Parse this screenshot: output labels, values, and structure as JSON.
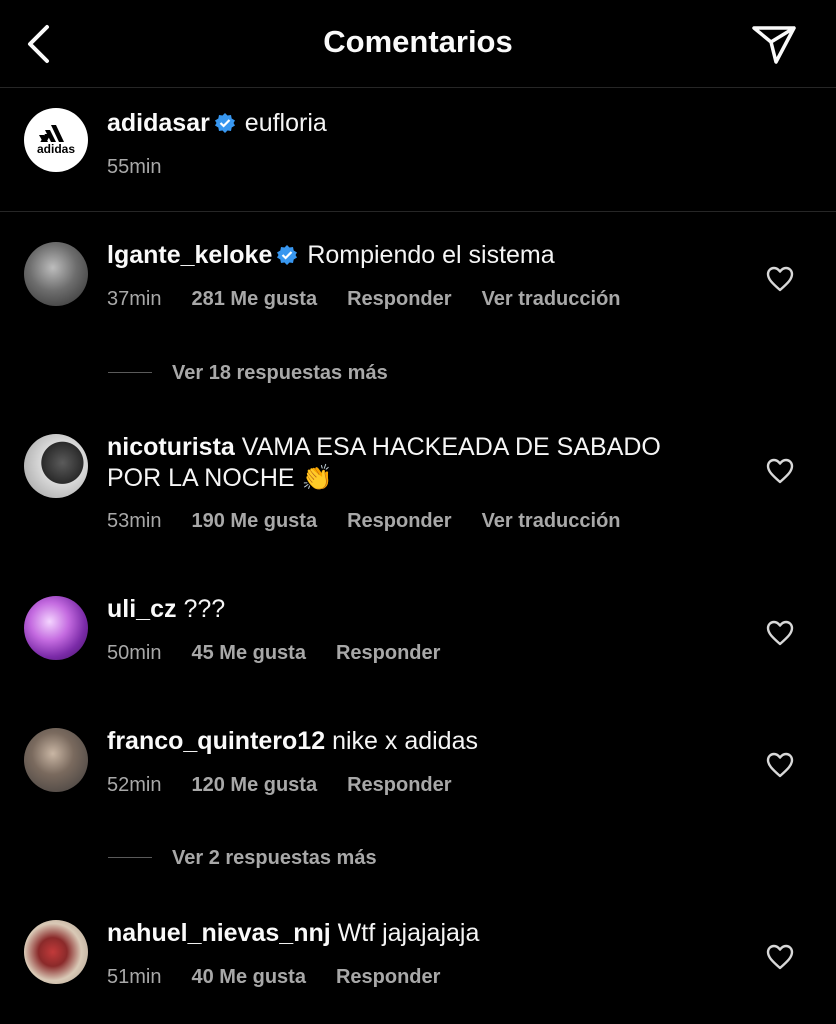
{
  "header": {
    "title": "Comentarios",
    "back_icon": "chevron-left-icon",
    "share_icon": "paper-plane-icon"
  },
  "caption": {
    "username": "adidasar",
    "verified": true,
    "text": "eufloria",
    "time": "55min",
    "avatar_text": "adidas"
  },
  "comments": [
    {
      "username": "lgante_keloke",
      "verified": true,
      "text": "Rompiendo el sistema",
      "time": "37min",
      "likes": "281 Me gusta",
      "reply": "Responder",
      "translate": "Ver traducción",
      "more_replies": "Ver 18 respuestas más"
    },
    {
      "username": "nicoturista",
      "verified": false,
      "text_line1": "VAMA ESA HACKEADA DE SABADO",
      "text_line2": "POR LA NOCHE",
      "emoji": "👏",
      "time": "53min",
      "likes": "190 Me gusta",
      "reply": "Responder",
      "translate": "Ver traducción"
    },
    {
      "username": "uli_cz",
      "verified": false,
      "text": "???",
      "time": "50min",
      "likes": "45 Me gusta",
      "reply": "Responder"
    },
    {
      "username": "franco_quintero12",
      "verified": false,
      "text": "nike x adidas",
      "time": "52min",
      "likes": "120 Me gusta",
      "reply": "Responder",
      "more_replies": "Ver 2 respuestas más"
    },
    {
      "username": "nahuel_nievas_nnj",
      "verified": false,
      "text": "Wtf jajajajaja",
      "time": "51min",
      "likes": "40 Me gusta",
      "reply": "Responder"
    }
  ],
  "colors": {
    "background": "#000000",
    "text": "#fafafa",
    "secondary": "#a8a8a8",
    "verified": "#3897f0",
    "divider": "#262626"
  }
}
